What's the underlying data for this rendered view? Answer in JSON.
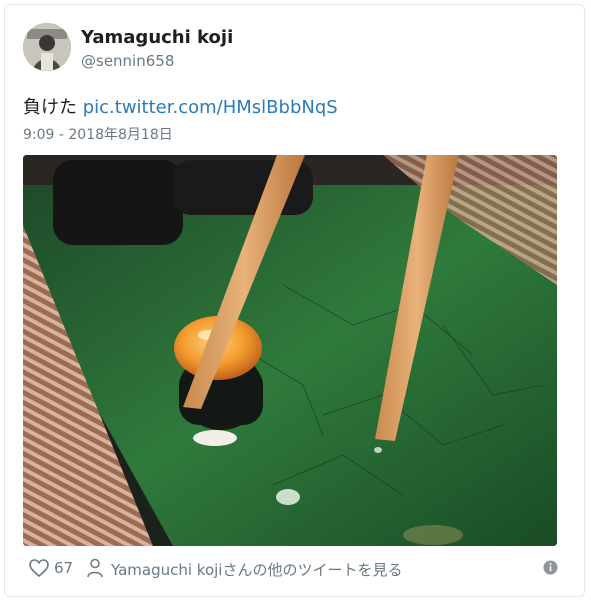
{
  "user": {
    "name": "Yamaguchi koji",
    "handle": "@sennin658"
  },
  "tweet": {
    "text": "負けた",
    "link": "pic.twitter.com/HMslBbbNqS",
    "timestamp": "9:09 - 2018年8月18日"
  },
  "footer": {
    "like_count": "67",
    "more_tweets_label": "Yamaguchi kojiさんの他のツイートを見る"
  },
  "icons": {
    "like": "heart-icon",
    "user": "user-icon",
    "info": "info-icon"
  },
  "colors": {
    "link": "#2b7bb9",
    "secondary_text": "#697882",
    "border": "#e1e8ed"
  }
}
